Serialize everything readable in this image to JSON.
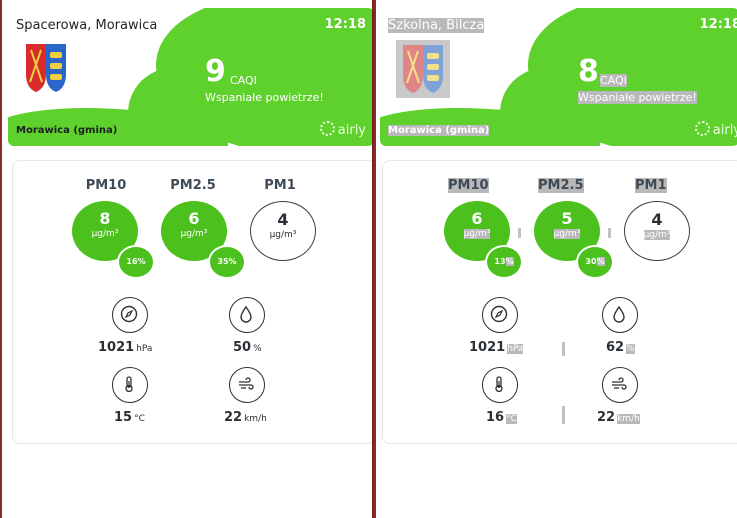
{
  "panels": [
    {
      "location": "Spacerowa, Morawica",
      "time": "12:18",
      "caqi_value": "9",
      "caqi_label": "CAQI",
      "caqi_description": "Wspaniałe powietrze!",
      "region": "Morawica (gmina)",
      "brand": "airly",
      "pm": [
        {
          "name": "PM10",
          "value": "8",
          "unit": "µg/m³",
          "percent": "16%"
        },
        {
          "name": "PM2.5",
          "value": "6",
          "unit": "µg/m³",
          "percent": "35%"
        },
        {
          "name": "PM1",
          "value": "4",
          "unit": "µg/m³"
        }
      ],
      "measurements": {
        "pressure": {
          "value": "1021",
          "unit": "hPa",
          "icon": "gauge-icon"
        },
        "humidity": {
          "value": "50",
          "unit": "%",
          "icon": "droplet-icon"
        },
        "temperature": {
          "value": "15",
          "unit": "°C",
          "icon": "thermometer-icon"
        },
        "wind": {
          "value": "22",
          "unit": "km/h",
          "icon": "wind-icon"
        }
      }
    },
    {
      "location": "Szkolna, Bilcza",
      "time": "12:18",
      "caqi_value": "8",
      "caqi_label": "CAQI",
      "caqi_description": "Wspaniałe powietrze!",
      "region": "Morawica (gmina)",
      "brand": "airly",
      "pm": [
        {
          "name": "PM10",
          "value": "6",
          "unit": "µg/m³",
          "percent_num": "13",
          "percent_sign": "%"
        },
        {
          "name": "PM2.5",
          "value": "5",
          "unit": "µg/m³",
          "percent_num": "30",
          "percent_sign": "%"
        },
        {
          "name": "PM1",
          "value": "4",
          "unit": "µg/m³"
        }
      ],
      "measurements": {
        "pressure": {
          "value": "1021",
          "unit": "hPa",
          "icon": "gauge-icon"
        },
        "humidity": {
          "value": "62",
          "unit": "%",
          "icon": "droplet-icon"
        },
        "temperature": {
          "value": "16",
          "unit": "°C",
          "icon": "thermometer-icon"
        },
        "wind": {
          "value": "22",
          "unit": "km/h",
          "icon": "wind-icon"
        }
      }
    }
  ],
  "colors": {
    "green": "#4cc11e",
    "header_green": "#5fd12c",
    "divider": "#7a2323"
  }
}
